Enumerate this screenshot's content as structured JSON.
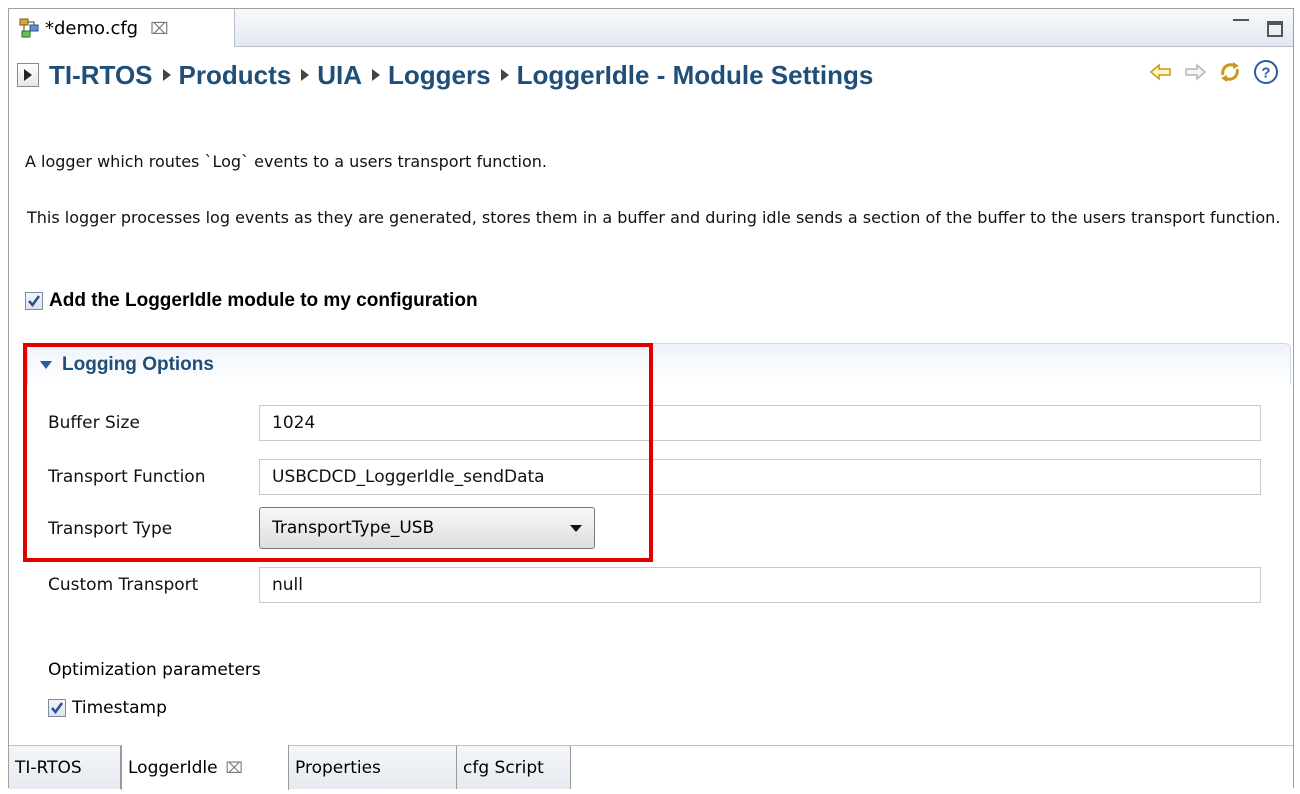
{
  "editor_tab": {
    "title": "*demo.cfg",
    "close_glyph": "⌧"
  },
  "breadcrumb": {
    "items": [
      "TI-RTOS",
      "Products",
      "UIA",
      "Loggers",
      "LoggerIdle - Module Settings"
    ]
  },
  "description": {
    "line1": "A logger which routes `Log` events to a users transport function.",
    "line2": "This logger processes log events as they are generated, stores them in a buffer and during idle sends a section of the buffer  to the users transport function."
  },
  "add_module": {
    "label": "Add the LoggerIdle module to my configuration",
    "checked": true
  },
  "section": {
    "title": "Logging Options",
    "fields": {
      "buffer_size": {
        "label": "Buffer Size",
        "value": "1024"
      },
      "transport_function": {
        "label": "Transport Function",
        "value": "USBCDCD_LoggerIdle_sendData"
      },
      "transport_type": {
        "label": "Transport Type",
        "value": "TransportType_USB"
      },
      "custom_transport": {
        "label": "Custom Transport",
        "value": "null"
      }
    },
    "optimization": {
      "label": "Optimization parameters",
      "timestamp_label": "Timestamp",
      "timestamp_checked": true
    }
  },
  "bottom_tabs": {
    "tirtos": "TI-RTOS",
    "loggeridle": "LoggerIdle",
    "close_glyph": "⌧",
    "properties": "Properties",
    "cfg_script": "cfg Script"
  },
  "colors": {
    "highlight": "#e00000",
    "breadcrumb": "#1f4e79",
    "check": "#2b4f8a"
  }
}
